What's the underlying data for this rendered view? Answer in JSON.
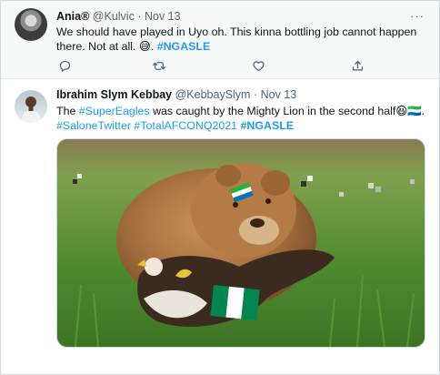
{
  "tweets": [
    {
      "name": "Ania®",
      "handle": "@Kulvic",
      "sep": "·",
      "date": "Nov 13",
      "more": "···",
      "text_line1": "We should have played in Uyo oh. This kinna bottling job cannot happen",
      "text_line2_plain": "there. Not at all. 😅. ",
      "hashtag": "#NGASLE",
      "actions": [
        "reply-icon",
        "retweet-icon",
        "like-icon",
        "share-icon"
      ]
    },
    {
      "name": "Ibrahim Slym Kebbay",
      "handle": "@KebbaySlym",
      "sep": "·",
      "date": "Nov 13",
      "text_pre": "The ",
      "tag_super": "#SuperEagles",
      "text_mid": " was caught by the Mighty Lion in the second half😆🇸🇱.",
      "tag_salone": "#SaloneTwitter",
      "tag_afcon": "#TotalAFCONQ2021",
      "tag_ngasle": "#NGASLE",
      "media": {
        "description_icon": "lion-eagle-photo",
        "flags": [
          "sierra-leone-flag",
          "nigeria-flag"
        ]
      }
    }
  ],
  "colors": {
    "link": "#1d9bf0",
    "muted": "#536471",
    "text": "#0f1419",
    "bg_hover": "#f7f9f9"
  }
}
